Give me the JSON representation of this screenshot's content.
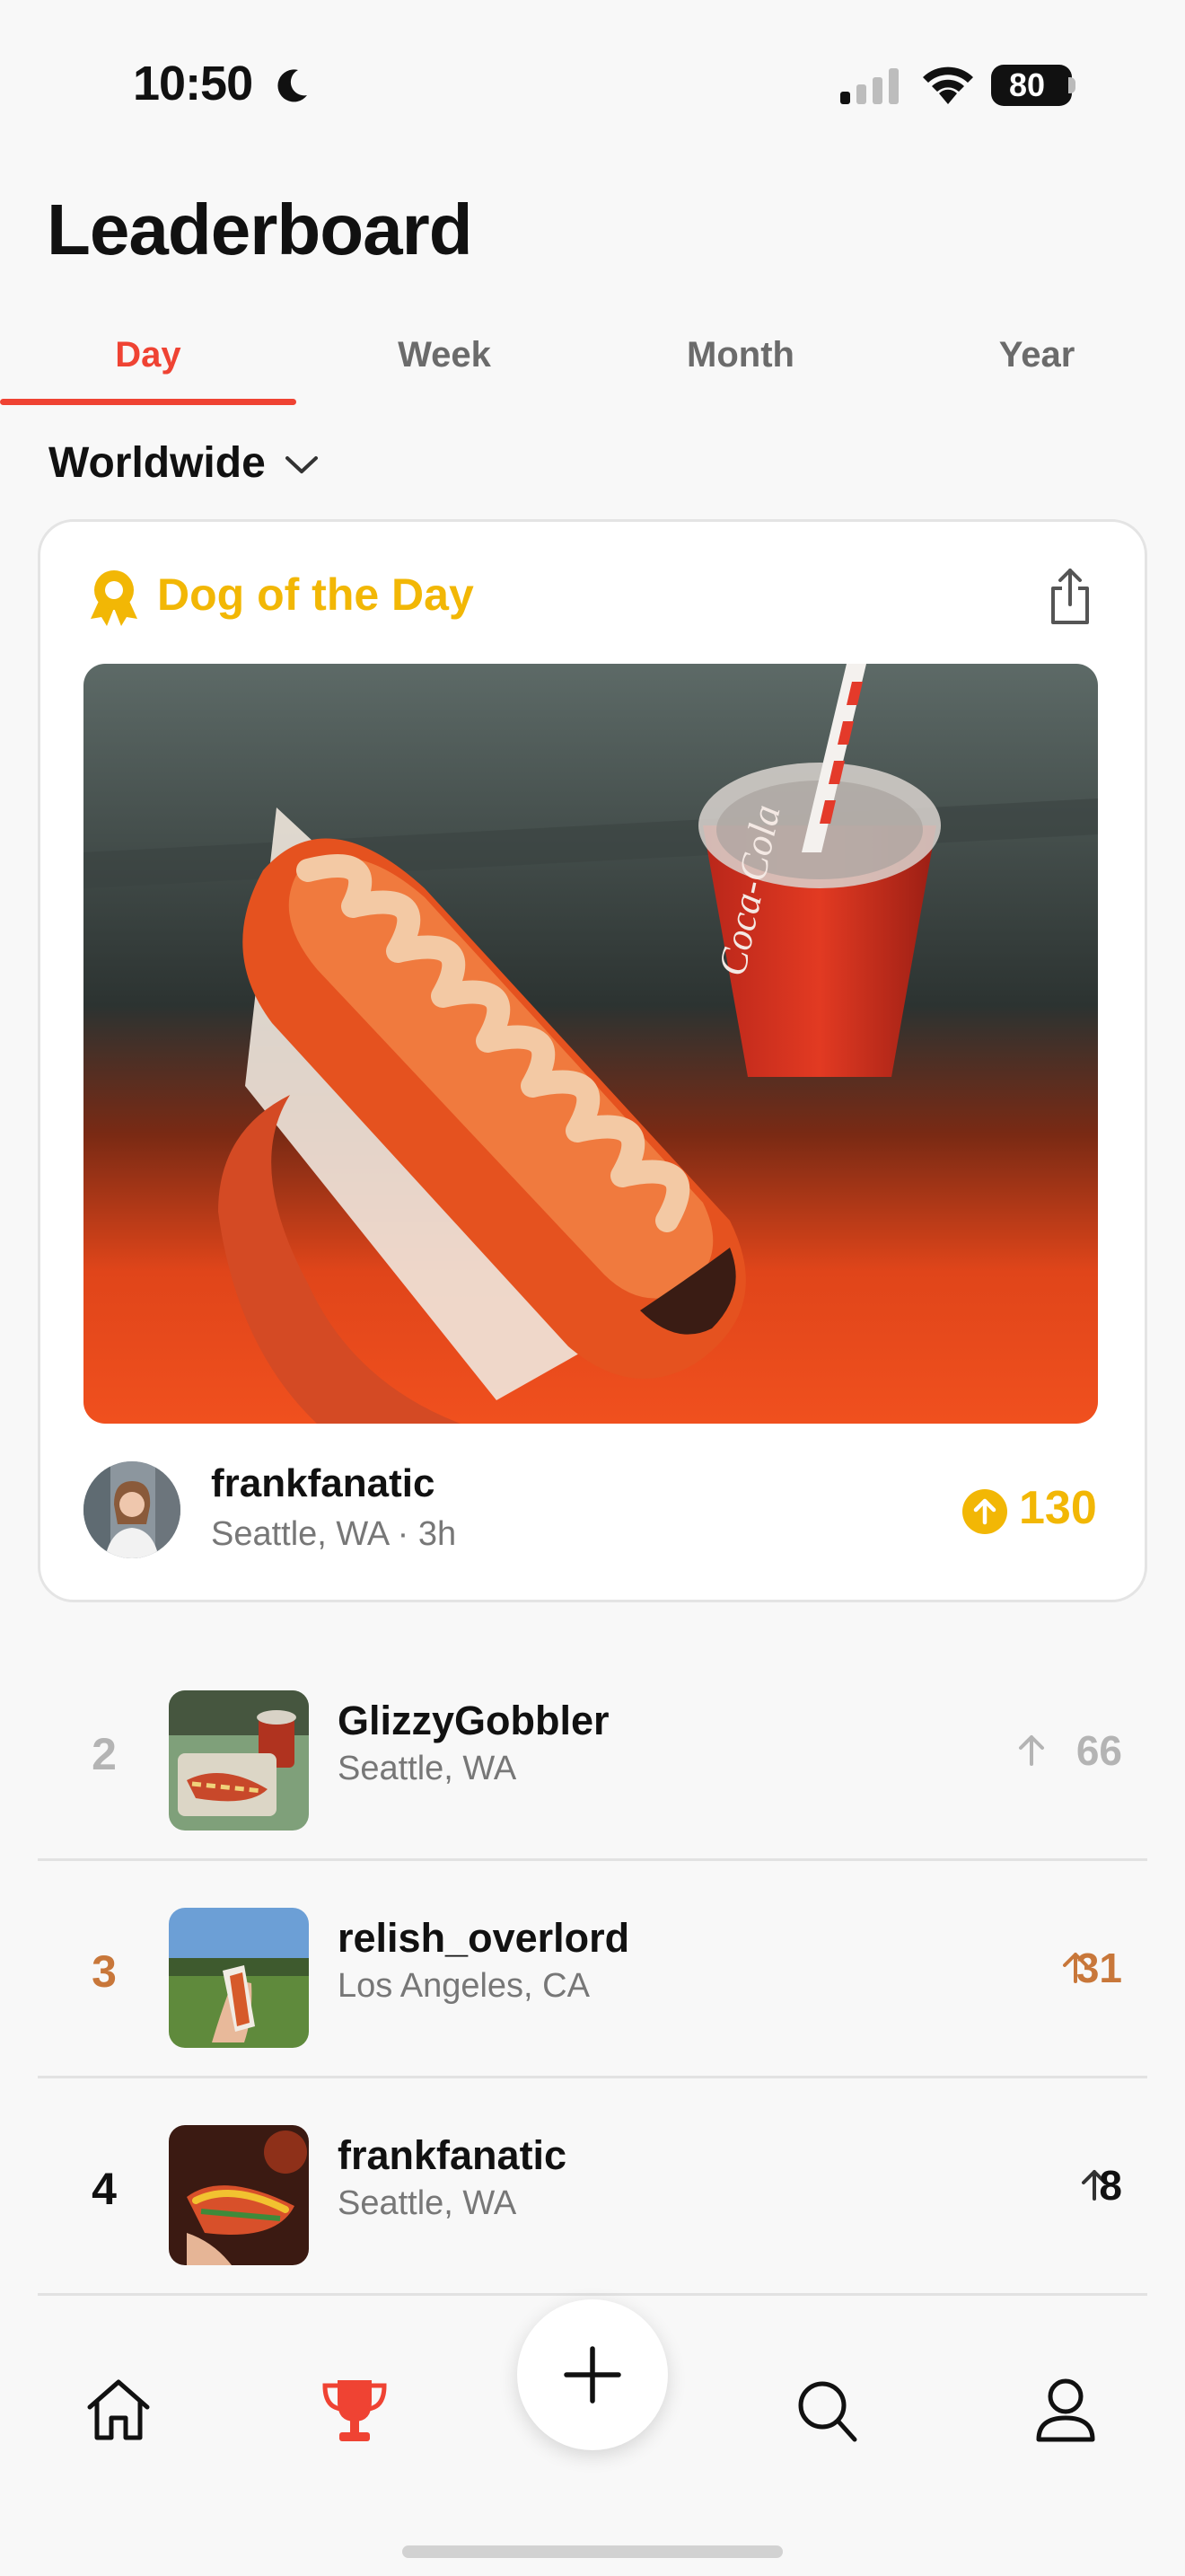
{
  "status_bar": {
    "time": "10:50",
    "battery": "80"
  },
  "page_title": "Leaderboard",
  "tabs": [
    {
      "label": "Day",
      "active": true
    },
    {
      "label": "Week",
      "active": false
    },
    {
      "label": "Month",
      "active": false
    },
    {
      "label": "Year",
      "active": false
    }
  ],
  "region": {
    "label": "Worldwide"
  },
  "featured": {
    "title": "Dog of the Day",
    "username": "frankfanatic",
    "meta": "Seattle, WA · 3h",
    "score": "130"
  },
  "entries": [
    {
      "rank": "2",
      "username": "GlizzyGobbler",
      "location": "Seattle, WA",
      "score": "66"
    },
    {
      "rank": "3",
      "username": "relish_overlord",
      "location": "Los Angeles, CA",
      "score": "31"
    },
    {
      "rank": "4",
      "username": "frankfanatic",
      "location": "Seattle, WA",
      "score": "8"
    }
  ],
  "colors": {
    "accent": "#ef4333",
    "gold": "#f2b705",
    "bronze": "#c8773a",
    "silver": "#b4b4b4"
  },
  "icons": [
    "moon-icon",
    "signal-icon",
    "wifi-icon",
    "battery-icon",
    "chevron-down-icon",
    "award-icon",
    "share-icon",
    "upvote-icon",
    "up-arrow-icon",
    "home-icon",
    "trophy-icon",
    "plus-icon",
    "search-icon",
    "profile-icon"
  ]
}
